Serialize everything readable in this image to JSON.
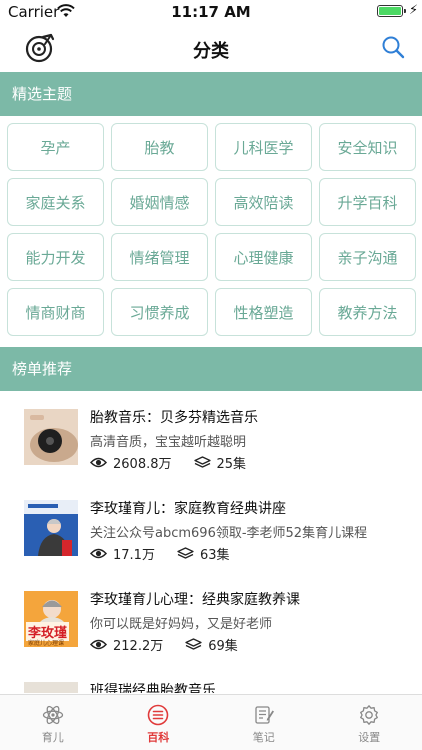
{
  "status_bar": {
    "carrier": "Carrier",
    "time": "11:17 AM"
  },
  "nav": {
    "title": "分类",
    "logo_icon": "music-disc-icon",
    "search_icon": "search-icon"
  },
  "featured": {
    "header": "精选主题",
    "categories": [
      "孕产",
      "胎教",
      "儿科医学",
      "安全知识",
      "家庭关系",
      "婚姻情感",
      "高效陪读",
      "升学百科",
      "能力开发",
      "情绪管理",
      "心理健康",
      "亲子沟通",
      "情商财商",
      "习惯养成",
      "性格塑造",
      "教养方法"
    ]
  },
  "ranking": {
    "header": "榜单推荐",
    "items": [
      {
        "title": "胎教音乐：贝多芬精选音乐",
        "desc": "高清音质，宝宝越听越聪明",
        "plays": "2608.8万",
        "episodes": "25集"
      },
      {
        "title": "李玫瑾育儿：家庭教育经典讲座",
        "desc": "关注公众号abcm696领取-李老师52集育儿课程",
        "plays": "17.1万",
        "episodes": "63集"
      },
      {
        "title": "李玫瑾育儿心理：经典家庭教养课",
        "desc": "你可以既是好妈妈，又是好老师",
        "plays": "212.2万",
        "episodes": "69集",
        "thumb_text": "李玫瑾",
        "thumb_sub": "家庭儿心理课"
      },
      {
        "title": "班得瑞经典胎教音乐",
        "desc": "",
        "plays": "",
        "episodes": ""
      }
    ]
  },
  "tabs": [
    {
      "label": "育儿",
      "icon": "atom-icon",
      "active": false
    },
    {
      "label": "百科",
      "icon": "list-icon",
      "active": true
    },
    {
      "label": "笔记",
      "icon": "notes-icon",
      "active": false
    },
    {
      "label": "设置",
      "icon": "gear-icon",
      "active": false
    }
  ],
  "colors": {
    "accent": "#7cb9a7",
    "category_text": "#6aa996",
    "tab_active": "#e03a3a"
  }
}
